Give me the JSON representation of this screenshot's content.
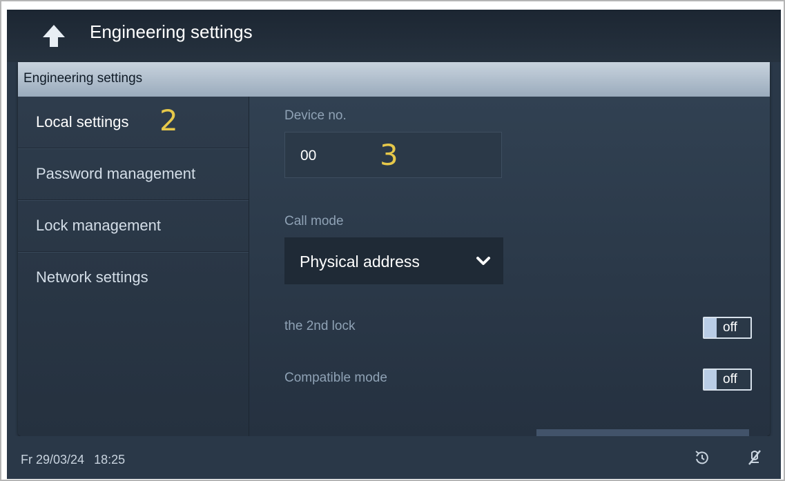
{
  "header": {
    "title": "Engineering settings",
    "back_icon": "back-arrow-icon"
  },
  "panel": {
    "title": "Engineering settings"
  },
  "sidebar": {
    "items": [
      {
        "label": "Local settings",
        "active": true
      },
      {
        "label": "Password management"
      },
      {
        "label": "Lock management"
      },
      {
        "label": "Network settings"
      }
    ]
  },
  "annotations": {
    "sidebar_marker": "2",
    "field_marker": "3"
  },
  "form": {
    "device_no_label": "Device no.",
    "device_no_value": "00",
    "call_mode_label": "Call mode",
    "call_mode_value": "Physical address",
    "second_lock_label": "the 2nd lock",
    "second_lock_state": "off",
    "compatible_mode_label": "Compatible mode",
    "compatible_mode_state": "off"
  },
  "status": {
    "date": "Fr 29/03/24",
    "time": "18:25",
    "icons": [
      "clock-icon",
      "mute-icon"
    ]
  },
  "colors": {
    "background": "#2a3848",
    "header_bar": "#b0bfcd",
    "annotation": "#e6c84a",
    "toggle_knob": "#b9cde6"
  }
}
